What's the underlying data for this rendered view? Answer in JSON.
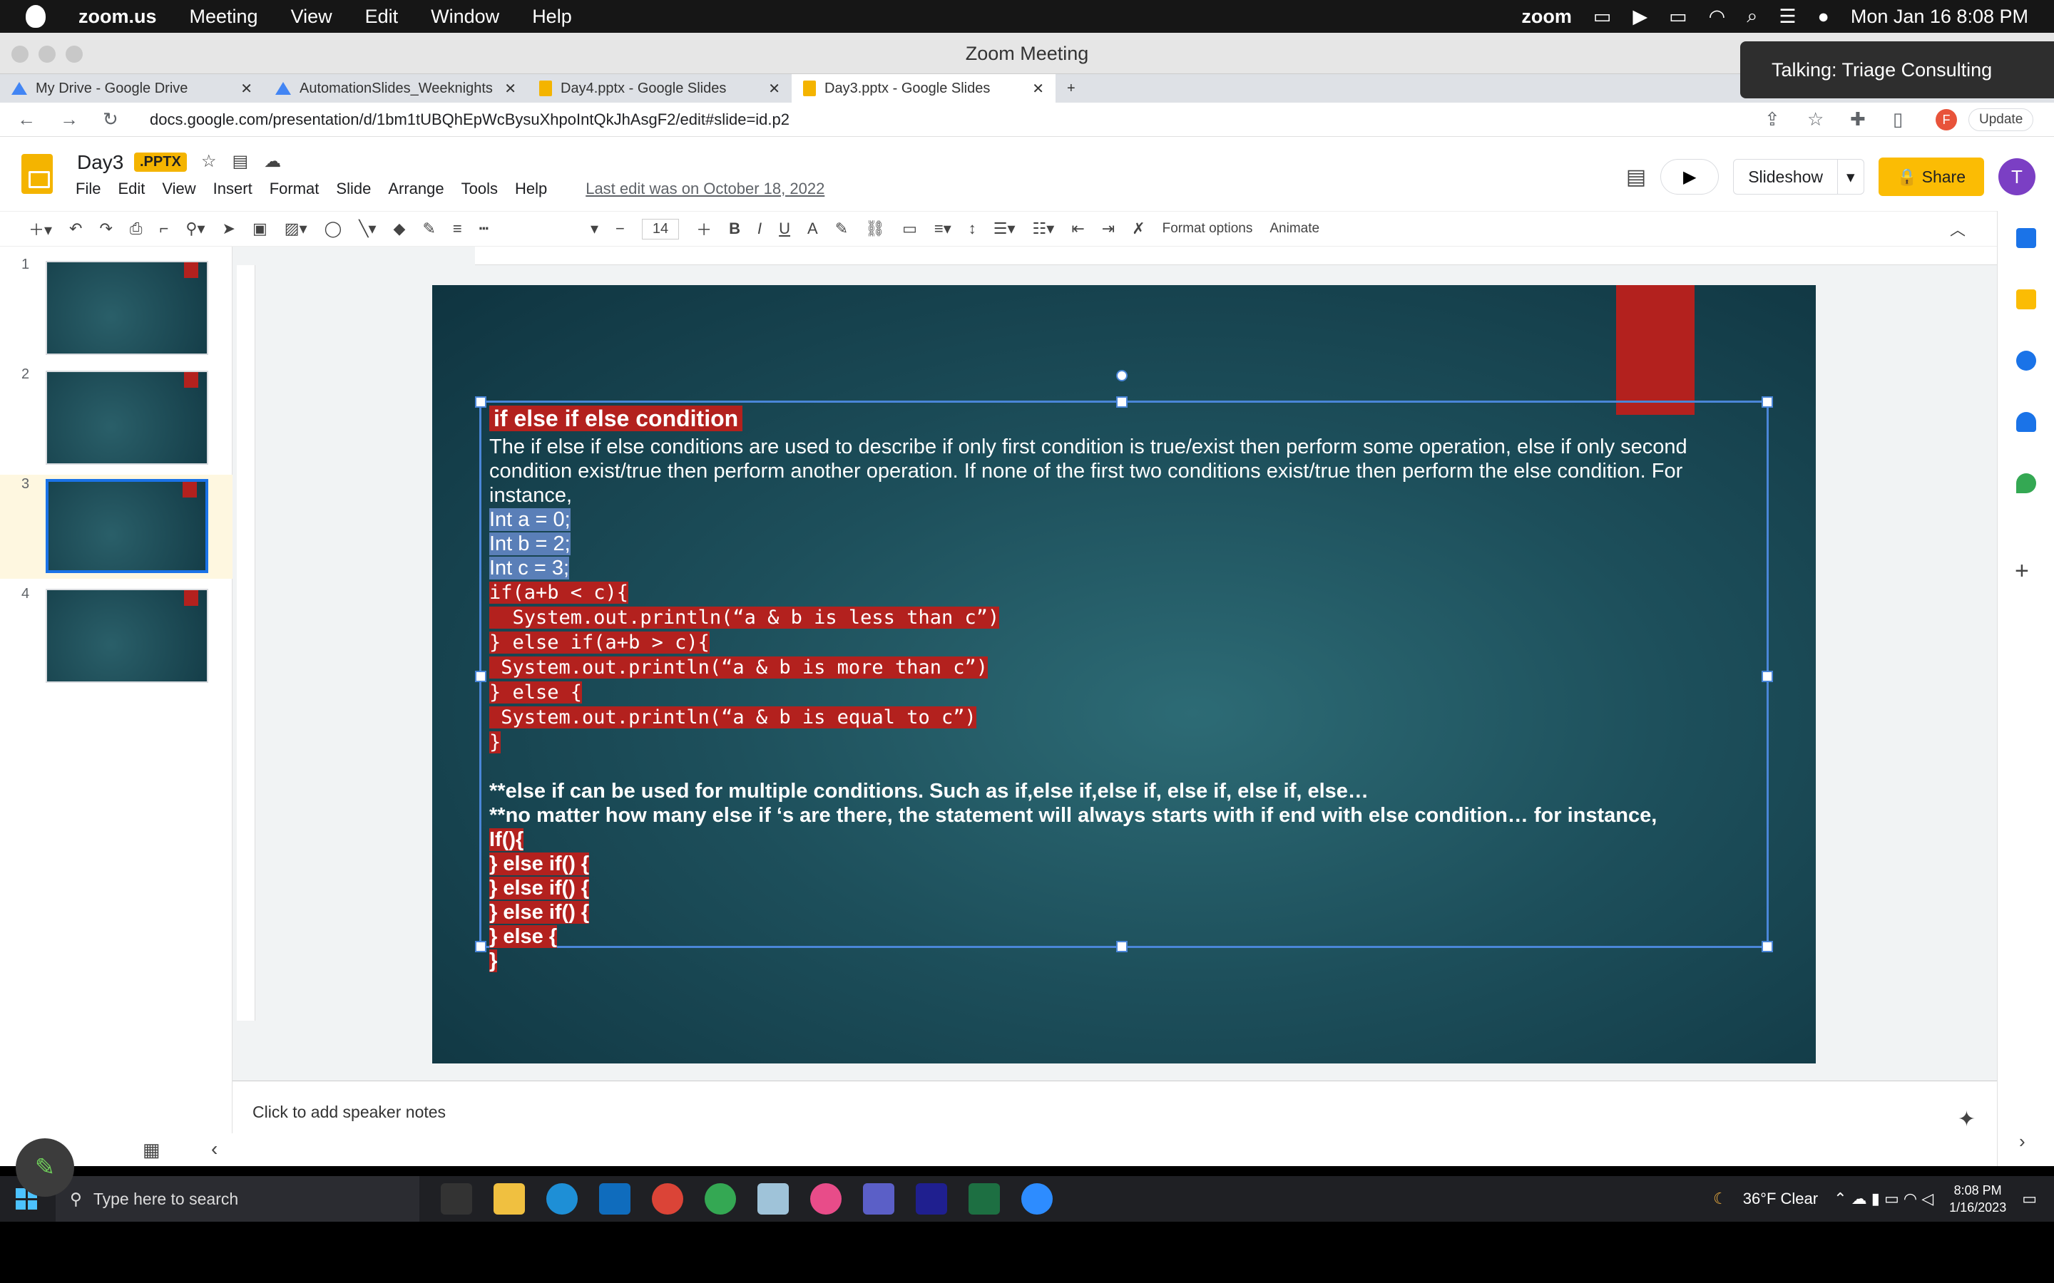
{
  "mac": {
    "app": "zoom.us",
    "menus": [
      "Meeting",
      "View",
      "Edit",
      "Window",
      "Help"
    ],
    "zoom_brand": "zoom",
    "datetime": "Mon Jan 16  8:08 PM"
  },
  "zoom": {
    "title": "Zoom Meeting",
    "talking": "Talking: Triage Consulting"
  },
  "browser": {
    "tabs": [
      {
        "label": "My Drive - Google Drive",
        "icon": "drive-icon"
      },
      {
        "label": "AutomationSlides_Weeknights -",
        "icon": "drive-icon"
      },
      {
        "label": "Day4.pptx - Google Slides",
        "icon": "slides-icon"
      },
      {
        "label": "Day3.pptx - Google Slides",
        "icon": "slides-icon"
      }
    ],
    "new_tab": "+",
    "url": "docs.google.com/presentation/d/1bm1tUBQhEpWcBysuXhpoIntQkJhAsgF2/edit#slide=id.p2",
    "profile_letter": "F",
    "update_label": "Update"
  },
  "slides": {
    "doc_title": "Day3",
    "badge": ".PPTX",
    "menus": [
      "File",
      "Edit",
      "View",
      "Insert",
      "Format",
      "Slide",
      "Arrange",
      "Tools",
      "Help"
    ],
    "last_edit": "Last edit was on October 18, 2022",
    "slideshow_label": "Slideshow",
    "share_label": "Share",
    "avatar": "T",
    "font_size": "14",
    "format_options": "Format options",
    "animate": "Animate",
    "speaker_notes": "Click to add speaker notes",
    "thumbnail_numbers": [
      "1",
      "2",
      "3",
      "4"
    ]
  },
  "slide": {
    "title": "if else if else condition",
    "para": "The if else if else conditions are used to describe if only first condition is true/exist then perform some operation, else if only second condition exist/true then perform another operation. If none of the first two conditions exist/true then perform the else condition. For instance,",
    "decls": [
      "Int a = 0;",
      "Int b = 2;",
      "Int c = 3;"
    ],
    "code": [
      "if(a+b < c){",
      "  System.out.println(“a & b is less than c”)",
      "} else if(a+b > c){",
      " System.out.println(“a & b is more than c”)",
      "} else {",
      " System.out.println(“a & b is equal to c”)",
      "}"
    ],
    "note1": "**else if can be used for multiple conditions. Such as if,else if,else if, else if, else if, else…",
    "note2": "**no matter how many else if ‘s are there, the statement will always starts with if end with else condition… for instance,",
    "tail": [
      "If(){",
      "} else if() {",
      "} else if() {",
      "} else if() {",
      "} else {",
      "}"
    ]
  },
  "taskbar": {
    "search_placeholder": "Type here to search",
    "weather": "36°F  Clear",
    "time": "8:08 PM",
    "date": "1/16/2023"
  },
  "colors": {
    "accent": "#1a73e8",
    "share": "#fbbc04",
    "code_bg": "#b3211e",
    "slide_bg": "#1d4f5b"
  }
}
